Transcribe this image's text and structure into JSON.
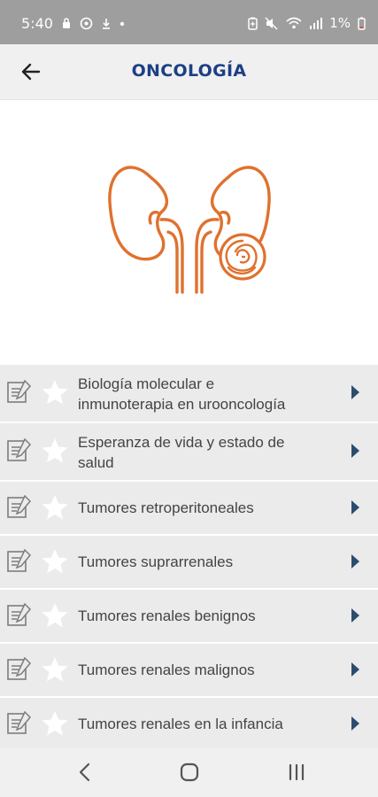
{
  "status_bar": {
    "time": "5:40",
    "battery": "1%",
    "icons": [
      "lock-icon",
      "whatsapp-icon",
      "download-icon",
      "dot-icon",
      "battery-saver-icon",
      "mute-icon",
      "wifi-icon",
      "signal-icon",
      "battery-icon"
    ]
  },
  "header": {
    "title": "ONCOLOGÍA",
    "back_icon": "arrow-left-icon"
  },
  "illustration": {
    "icon": "kidney-tumor-icon",
    "color": "#e0712e"
  },
  "topics": [
    {
      "label": "Biología molecular e inmunoterapia en urooncología",
      "line1": "Biología molecular e",
      "line2": "inmunoterapia en urooncología"
    },
    {
      "label": "Esperanza de vida y estado de salud",
      "line1": "Esperanza de vida y estado de",
      "line2": "salud"
    },
    {
      "label": "Tumores retroperitoneales"
    },
    {
      "label": "Tumores suprarrenales"
    },
    {
      "label": "Tumores renales benignos"
    },
    {
      "label": "Tumores renales malignos"
    },
    {
      "label": "Tumores renales en la infancia"
    }
  ],
  "colors": {
    "title": "#1d3f86",
    "chevron": "#2b4c6f",
    "row_background": "#ebebeb",
    "status_bar": "#9e9e9e"
  },
  "nav_bar": {
    "icons": [
      "back-icon",
      "home-icon",
      "recents-icon"
    ]
  }
}
